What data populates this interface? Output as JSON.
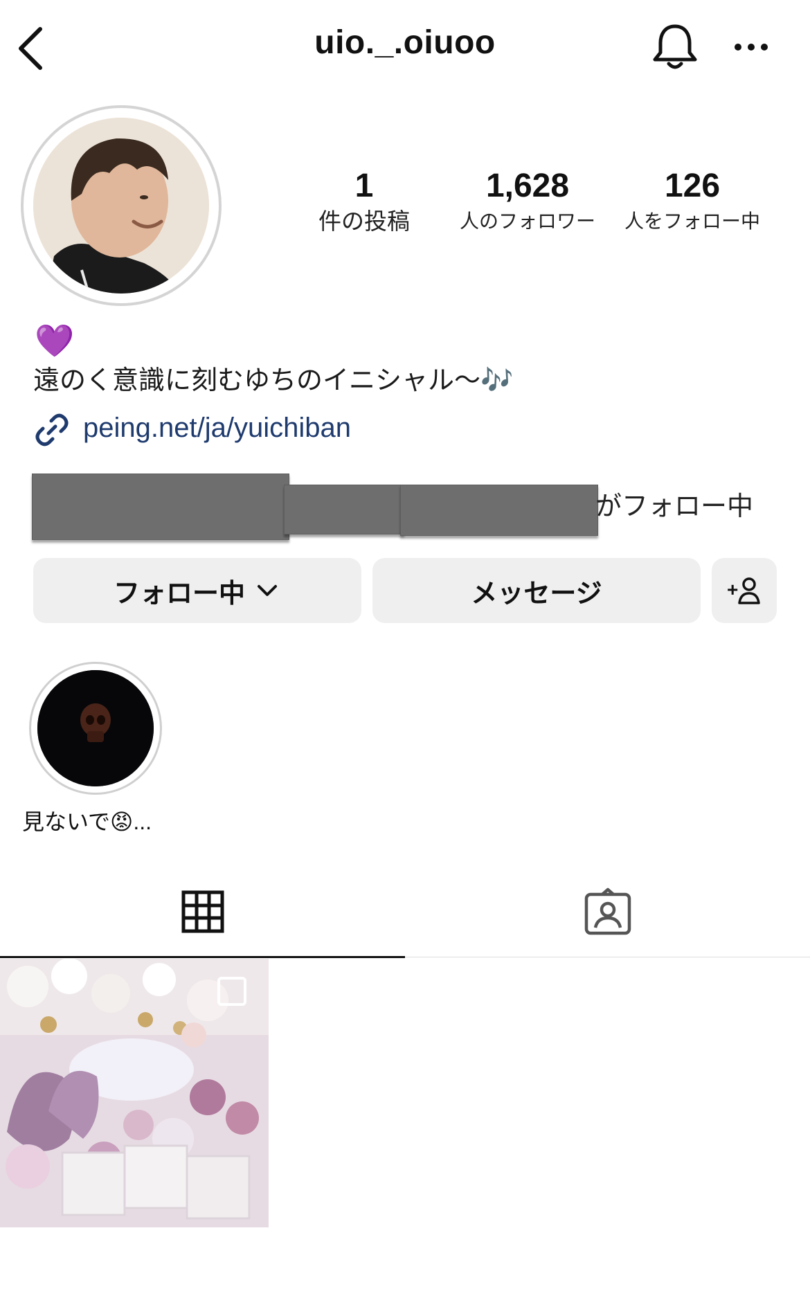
{
  "header": {
    "username": "uio._.oiuoo",
    "back_icon": "chevron-left-icon",
    "bell_icon": "bell-icon",
    "more_icon": "more-horizontal-icon"
  },
  "stats": {
    "posts": {
      "value": "1",
      "label": "件の投稿"
    },
    "followers": {
      "value": "1,628",
      "label": "人のフォロワー"
    },
    "following": {
      "value": "126",
      "label": "人をフォロー中"
    }
  },
  "bio": {
    "emoji": "💜",
    "text": "遠のく意識に刻むゆちのイニシャル〜🎶",
    "link": "peing.net/ja/yuichiban"
  },
  "followed_by": {
    "suffix": "がフォロー中"
  },
  "actions": {
    "following_label": "フォロー中",
    "message_label": "メッセージ",
    "add_user_label": "+"
  },
  "highlights": [
    {
      "label": "見ないで😡..."
    }
  ],
  "tabs": {
    "grid_icon": "grid-icon",
    "tagged_icon": "tagged-person-icon"
  },
  "colors": {
    "link": "#1f3b6e",
    "button_bg": "#efefef",
    "redaction": "#6e6e6e"
  }
}
